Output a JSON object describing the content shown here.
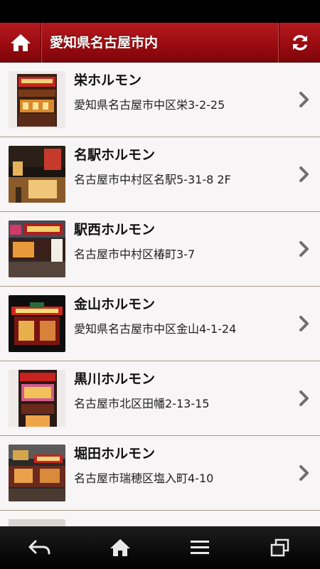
{
  "header": {
    "title": "愛知県名古屋市内",
    "home_icon": "home-icon",
    "refresh_icon": "refresh-icon"
  },
  "stores": [
    {
      "name": "栄ホルモン",
      "address": "愛知県名古屋市中区栄3-2-25"
    },
    {
      "name": "名駅ホルモン",
      "address": "名古屋市中村区名駅5-31-8 2F"
    },
    {
      "name": "駅西ホルモン",
      "address": "名古屋市中村区椿町3-7"
    },
    {
      "name": "金山ホルモン",
      "address": "愛知県名古屋市中区金山4-1-24"
    },
    {
      "name": "黒川ホルモン",
      "address": "名古屋市北区田幡2-13-15"
    },
    {
      "name": "堀田ホルモン",
      "address": "名古屋市瑞穂区塩入町4-10"
    }
  ],
  "nav": {
    "back_icon": "back-icon",
    "home_icon": "home-icon",
    "menu_icon": "menu-icon",
    "recent_apps_icon": "recent-apps-icon"
  },
  "colors": {
    "header": "#9a0c11",
    "list_background": "#f7f5f6",
    "divider": "#a99a8a",
    "chevron": "#6e6e6e"
  }
}
